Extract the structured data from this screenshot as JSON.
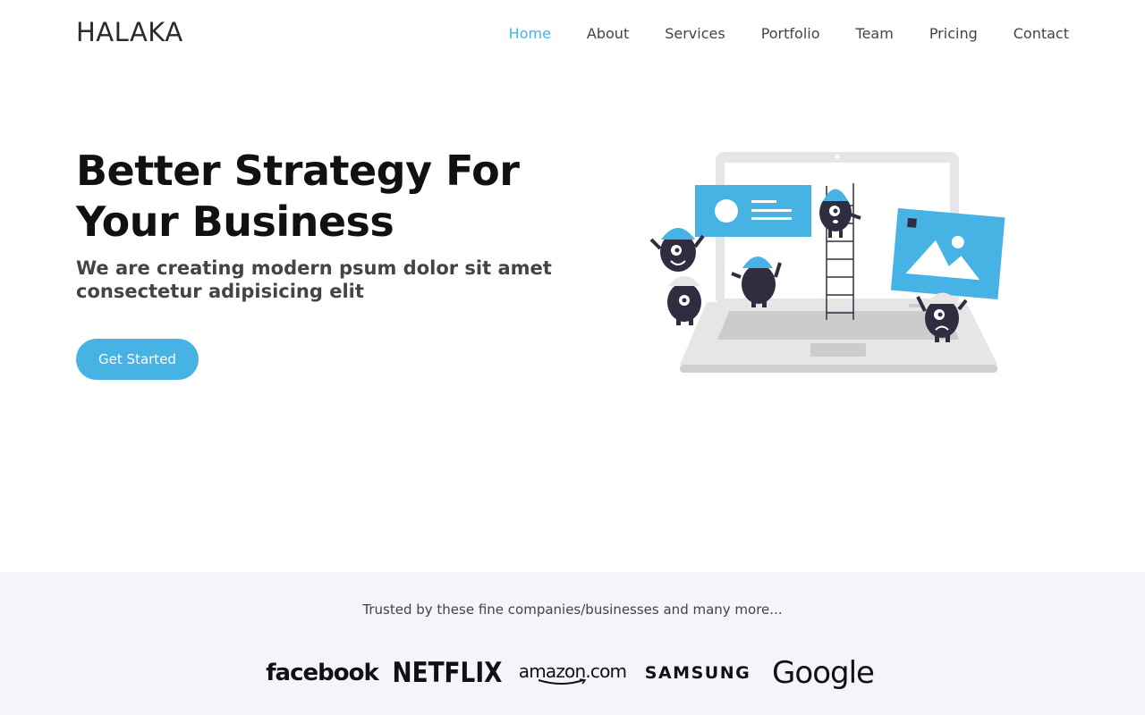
{
  "header": {
    "logo": "HALAKA",
    "nav": [
      {
        "label": "Home",
        "active": true
      },
      {
        "label": "About",
        "active": false
      },
      {
        "label": "Services",
        "active": false
      },
      {
        "label": "Portfolio",
        "active": false
      },
      {
        "label": "Team",
        "active": false
      },
      {
        "label": "Pricing",
        "active": false
      },
      {
        "label": "Contact",
        "active": false
      }
    ]
  },
  "hero": {
    "title": "Better Strategy For Your Business",
    "subtitle": "We are creating modern psum dolor sit amet consectetur adipisicing elit",
    "cta_label": "Get Started",
    "illustration_icon": "laptop-team-illustration"
  },
  "clients": {
    "intro": "Trusted by these fine companies/businesses and many more...",
    "brands": [
      "facebook",
      "NETFLIX",
      "amazon.com",
      "SAMSUNG",
      "Google"
    ]
  },
  "colors": {
    "accent": "#47b2e4",
    "heading": "#111111",
    "band_background": "#f3f5fa",
    "figure_dark": "#2f2e41"
  }
}
